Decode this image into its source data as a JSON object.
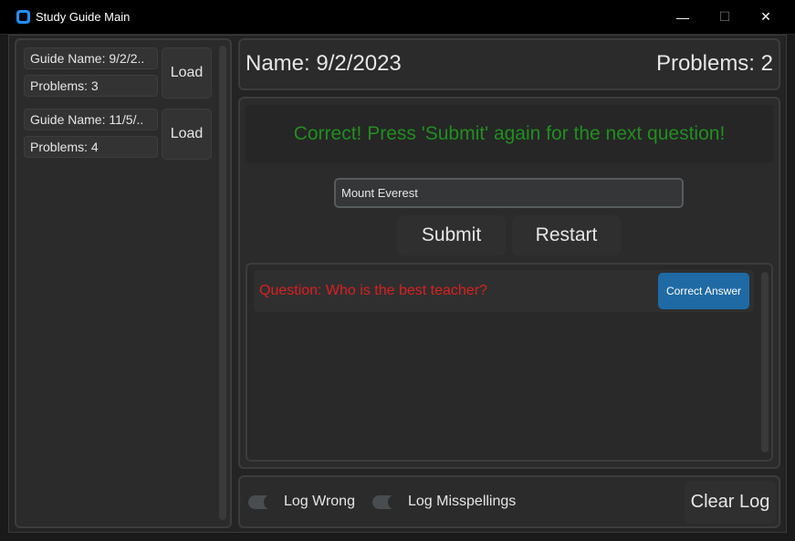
{
  "window": {
    "title": "Study Guide Main",
    "controls": {
      "minimize": "—",
      "maximize": "☐",
      "close": "✕"
    }
  },
  "sidebar": {
    "guides": [
      {
        "name_label": "Guide Name: 9/2/2..",
        "problems_label": "Problems: 3",
        "load_label": "Load"
      },
      {
        "name_label": "Guide Name: 11/5/..",
        "problems_label": "Problems: 4",
        "load_label": "Load"
      }
    ]
  },
  "header": {
    "name": "Name: 9/2/2023",
    "problems": "Problems: 2"
  },
  "quiz": {
    "feedback": "Correct! Press 'Submit' again for the next question!",
    "answer_value": "Mount Everest",
    "submit_label": "Submit",
    "restart_label": "Restart"
  },
  "log": {
    "question": "Question: Who is the best teacher?",
    "correct_answer_label": "Correct Answer"
  },
  "bottom": {
    "log_wrong_label": "Log Wrong",
    "log_misspellings_label": "Log Misspellings",
    "clear_log_label": "Clear Log"
  },
  "colors": {
    "feedback": "#1f8f1f",
    "question": "#dd1f1f",
    "accent_button": "#1f6aa5",
    "app_icon": "#1e90ff"
  }
}
